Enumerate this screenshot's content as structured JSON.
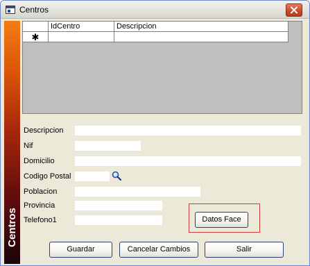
{
  "window": {
    "title": "Centros",
    "sidebar_label": "Centros"
  },
  "grid": {
    "columns": [
      "",
      "IdCentro",
      "Descripcion"
    ],
    "new_row_marker": "✱"
  },
  "form": {
    "descripcion": {
      "label": "Descripcion",
      "value": ""
    },
    "nif": {
      "label": "Nif",
      "value": ""
    },
    "domicilio": {
      "label": "Domicilio",
      "value": ""
    },
    "codigo_postal": {
      "label": "Codigo Postal",
      "value": ""
    },
    "poblacion": {
      "label": "Poblacion",
      "value": ""
    },
    "provincia": {
      "label": "Provincia",
      "value": ""
    },
    "telefono1": {
      "label": "Telefono1",
      "value": ""
    }
  },
  "buttons": {
    "datos_face": "Datos Face",
    "guardar": "Guardar",
    "cancelar": "Cancelar Cambios",
    "salir": "Salir"
  },
  "colors": {
    "sidebar_top": "#f47b16",
    "sidebar_bottom": "#1a0608",
    "highlight_frame": "#c93a3a"
  }
}
